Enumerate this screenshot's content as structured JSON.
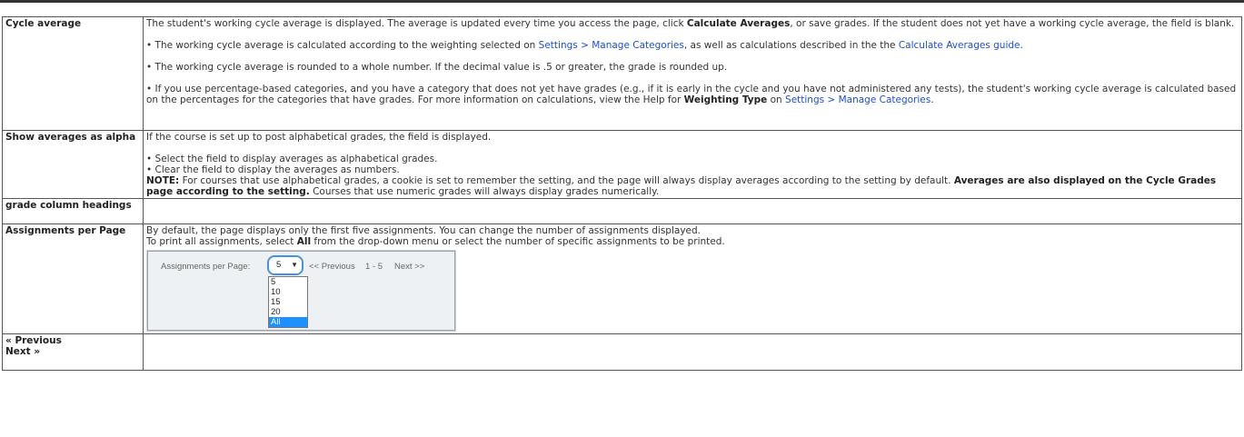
{
  "rows": {
    "cycle_average": {
      "term": "Cycle average",
      "p1": {
        "a": "The student's working cycle average is displayed. The average is updated every time you access the page, click ",
        "b": "Calculate Averages",
        "c": ", or save grades. If the student does not yet have a working cycle average, the field is blank."
      },
      "p2": {
        "a": "• The working cycle average is calculated according to the weighting selected on ",
        "link1": "Settings > Manage Categories",
        "b": ", as well as calculations described in the the ",
        "link2": "Calculate Averages guide",
        "c": "."
      },
      "p3": "• The working cycle average is rounded to a whole number. If the decimal value is .5 or greater, the grade is rounded up.",
      "p4": {
        "a": "• If you use percentage-based categories, and you have a category that does not yet have grades (e.g., if it is early in the cycle and you have not administered any tests), the student's working cycle average is calculated based on the percentages for the categories that have grades. For more information on calculations, view the Help for ",
        "b": "Weighting Type",
        "c": " on ",
        "link": "Settings > Manage Categories",
        "d": "."
      }
    },
    "show_alpha": {
      "term": "Show averages as alpha",
      "p1": "If the course is set up to post alphabetical grades, the field is displayed.",
      "p2": "• Select the field to display averages as alphabetical grades.",
      "p3": "• Clear the field to display the averages as numbers.",
      "note": {
        "label": "NOTE:",
        "a": " For courses that use alphabetical grades, a cookie is set to remember the setting, and the page will always display averages according to the setting by default. ",
        "b": "Averages are also displayed on the Cycle Grades page according to the setting.",
        "c": " Courses that use numeric grades will always display grades numerically."
      }
    },
    "grade_headings": {
      "term": "grade column headings"
    },
    "assignments_per_page": {
      "term": "Assignments per Page",
      "p1": "By default, the page displays only the first five assignments. You can change the number of assignments displayed.",
      "p2": {
        "a": "To print all assignments, select ",
        "b": "All",
        "c": " from the drop-down menu or select the number of specific assignments to be printed."
      },
      "demo": {
        "label": "Assignments per Page:",
        "selected": "5",
        "prev": "<< Previous",
        "range": "1 - 5",
        "next": "Next >>",
        "options": [
          "5",
          "10",
          "15",
          "20",
          "All"
        ]
      }
    },
    "prev_next": {
      "term_prev": "« Previous",
      "term_next": "Next »"
    }
  }
}
